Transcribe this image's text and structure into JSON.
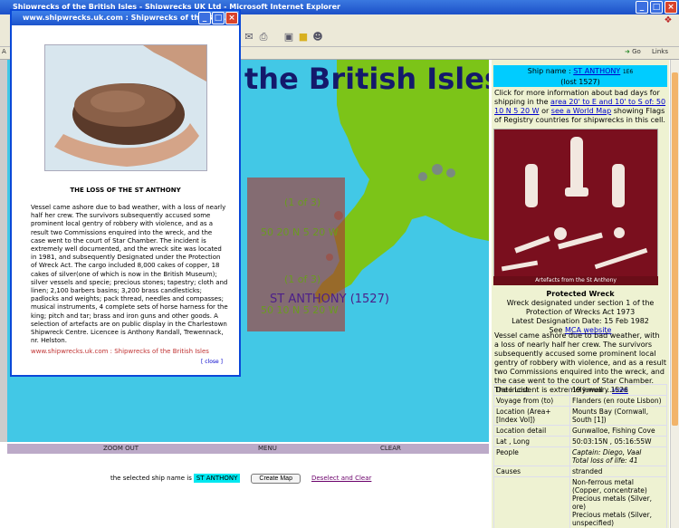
{
  "browser": {
    "title": "Shipwrecks of the British Isles - Shipwrecks UK Ltd - Microsoft Internet Explorer",
    "address_label": "A",
    "go_label": "Go",
    "links_label": "Links"
  },
  "map": {
    "title": "the British Isles",
    "grid_label_1": "(1 of 3)",
    "grid_coord_1": "50 20 N 5 20 W",
    "grid_label_2": "(1 of 3)",
    "grid_coord_2": "50 10 N 5 20 W",
    "ship_label": "ST ANTHONY (1527)"
  },
  "nav": {
    "zoom_out": "ZOOM OUT",
    "menu": "MENU",
    "clear": "CLEAR"
  },
  "selection": {
    "prefix": "the selected ship name is",
    "value": "ST ANTHONY",
    "create_map": "Create Map",
    "deselect": "Deselect and Clear"
  },
  "info": {
    "ship_name_label": "Ship name :",
    "ship_name": "ST ANTHONY",
    "ship_code": "1E6",
    "ship_lost": "(lost 1527)",
    "click_pre": "Click for more information about bad days for shipping in the",
    "area_link": "area 20' to E and 10' to S of: 50 10 N 5 20 W",
    "or_text": "or",
    "world_link": "see a World Map",
    "click_post": "showing Flags of Registry countries for shipwrecks in this cell.",
    "photo_caption": "Artefacts from the St Anthony",
    "protected_heading": "Protected Wreck",
    "protected_line1": "Wreck designated under section 1 of the Protection of Wrecks Act 1973",
    "protected_line2": "Latest Designation Date: 15 Feb 1982",
    "see": "See",
    "mca_link": "MCA website",
    "description": "Vessel came ashore due to bad weather, with a loss of nearly half her crew. The survivors subsequently accused some prominent local gentry of robbery with violence, and as a result two Commissions enquired into the wreck, and the case went to the court of Star Chamber. The incident is extremely well ...",
    "more_link": "MORE",
    "table": [
      {
        "k": "Date Lost",
        "v": "19 January 1526"
      },
      {
        "k": "Voyage from (to)",
        "v": "Flanders (en route Lisbon)"
      },
      {
        "k": "Location (Area+ [Index Vol])",
        "v": "Mounts Bay (Cornwall, South [1])"
      },
      {
        "k": "Location detail",
        "v": "Gunwalloe, Fishing Cove"
      },
      {
        "k": "Lat , Long",
        "v": "50:03:15N , 05:16:55W"
      },
      {
        "k": "People",
        "v": "Captain: Diego, Vaal",
        "v2": "Total loss of life: 41"
      },
      {
        "k": "Causes",
        "v": "stranded"
      },
      {
        "k": "",
        "v": "Non-ferrous metal (Copper, concentrate)\nPrecious metals (Silver, ore)\nPrecious metals (Silver, unspecified)\nPrecious metals (Specie, unspecified)"
      }
    ]
  },
  "popup": {
    "title": "www.shipwrecks.uk.com : Shipwrecks of the Briti...",
    "caption": "THE LOSS OF THE ST ANTHONY",
    "text": "Vessel came ashore due to bad weather, with a loss of nearly half her crew. The survivors subsequently accused some prominent local gentry of robbery with violence, and as a result two Commissions enquired into the wreck, and the case went to the court of Star Chamber. The incident is extremely well documented, and the wreck site was located in 1981, and subsequently Designated under the Protection of Wreck Act. The cargo included 8,000 cakes of copper, 18 cakes of silver(one of which is now in the British Museum); silver vessels and specie; precious stones; tapestry; cloth and linen; 2,100 barbers basins; 3,200 brass candlesticks; padlocks and weights; pack thread, needles and compasses; musical instruments, 4 complete sets of horse harness for the king; pitch and tar; brass and iron guns and other goods. A selection of artefacts are on public display in the Charlestown Shipwreck Centre. Licencee is Anthony Randall, Trewennack, nr. Helston.",
    "footer": "www.shipwrecks.uk.com : Shipwrecks of the British Isles",
    "close": "[ close ]"
  },
  "colors": {
    "sea": "#42c8e6",
    "land": "#7cc418",
    "highlight": "#a83a34",
    "title": "#14196b",
    "panel": "#eef2d2",
    "ship_box": "#00ccff"
  },
  "icons": [
    "ie-icon",
    "minimize-icon",
    "maximize-icon",
    "close-icon",
    "print-icon",
    "mail-icon",
    "folder-icon",
    "messenger-icon",
    "windows-logo-icon",
    "go-arrow-icon"
  ]
}
